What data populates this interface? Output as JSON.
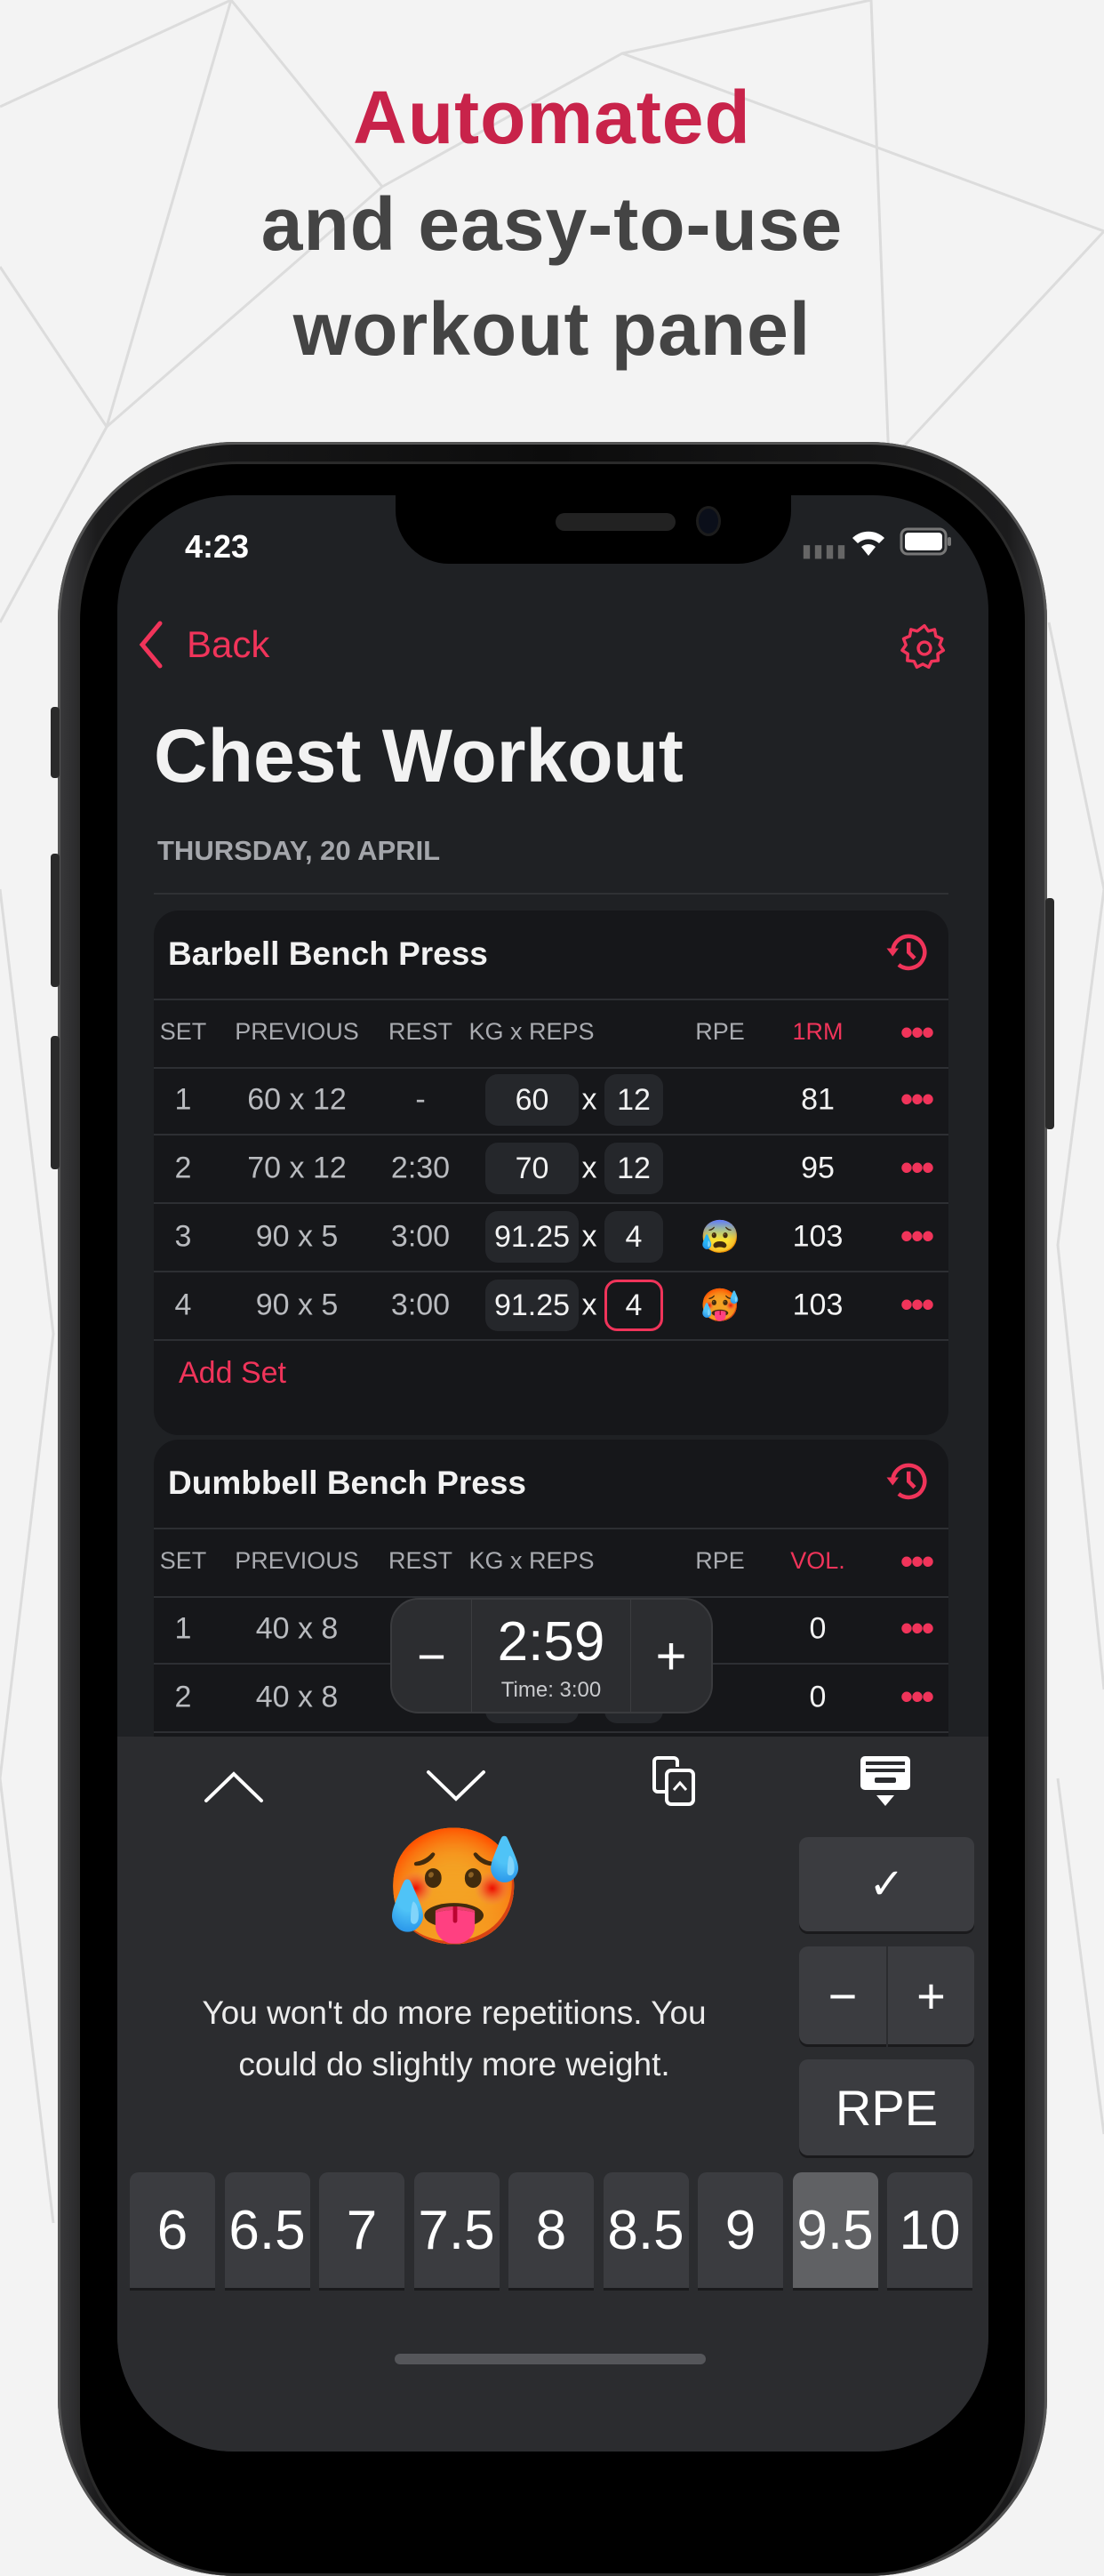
{
  "headline": {
    "line1": "Automated",
    "line2": "and easy-to-use",
    "line3": "workout panel",
    "accent": "#c8234a",
    "text_color": "#444444"
  },
  "status": {
    "time": "4:23"
  },
  "nav": {
    "back_label": "Back",
    "settings_icon": "gear-icon"
  },
  "title": "Chest Workout",
  "date": "THURSDAY, 20 APRIL",
  "accent_color": "#f0345a",
  "exercises": [
    {
      "name": "Barbell Bench Press",
      "columns": [
        "SET",
        "PREVIOUS",
        "REST",
        "KG x REPS",
        "RPE",
        "1RM"
      ],
      "sets": [
        {
          "set": "1",
          "previous": "60 x 12",
          "rest": "-",
          "kg": "60",
          "reps": "12",
          "rpe": "",
          "metric": "81"
        },
        {
          "set": "2",
          "previous": "70 x 12",
          "rest": "2:30",
          "kg": "70",
          "reps": "12",
          "rpe": "",
          "metric": "95"
        },
        {
          "set": "3",
          "previous": "90 x 5",
          "rest": "3:00",
          "kg": "91.25",
          "reps": "4",
          "rpe": "😰",
          "metric": "103"
        },
        {
          "set": "4",
          "previous": "90 x 5",
          "rest": "3:00",
          "kg": "91.25",
          "reps": "4",
          "rpe": "🥵",
          "metric": "103",
          "active": true
        }
      ],
      "add_set": "Add Set"
    },
    {
      "name": "Dumbbell Bench Press",
      "columns": [
        "SET",
        "PREVIOUS",
        "REST",
        "KG x REPS",
        "RPE",
        "VOL."
      ],
      "sets": [
        {
          "set": "1",
          "previous": "40 x 8",
          "rest": "",
          "kg": "",
          "reps": "",
          "rpe": "",
          "metric": "0"
        },
        {
          "set": "2",
          "previous": "40 x 8",
          "rest": "",
          "kg": "",
          "reps": "",
          "rpe": "",
          "metric": "0"
        }
      ]
    }
  ],
  "timer": {
    "value": "2:59",
    "subtitle": "Time: 3:00",
    "minus": "−",
    "plus": "+"
  },
  "rpe_panel": {
    "emoji": "🥵",
    "message_line1": "You won't do more repetitions. You",
    "message_line2": "could do slightly more weight.",
    "done": "✓",
    "minus": "−",
    "plus": "+",
    "rpe_label": "RPE",
    "values": [
      "6",
      "6.5",
      "7",
      "7.5",
      "8",
      "8.5",
      "9",
      "9.5",
      "10"
    ],
    "selected": "9.5"
  }
}
